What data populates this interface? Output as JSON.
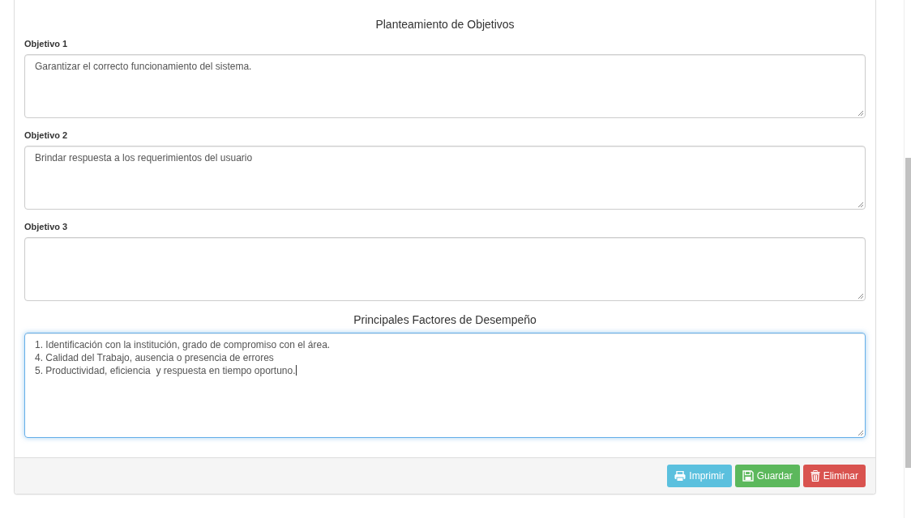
{
  "section_1": {
    "heading": "Planteamiento de Objetivos"
  },
  "objectives": [
    {
      "label": "Objetivo 1",
      "value": "Garantizar el correcto funcionamiento del sistema.",
      "focused": false
    },
    {
      "label": "Objetivo 2",
      "value": "Brindar respuesta a los requerimientos del usuario",
      "focused": false
    },
    {
      "label": "Objetivo 3",
      "focused": false
    }
  ],
  "section_2": {
    "heading": "Principales Factores de Desempeño"
  },
  "factors": {
    "lines": [
      "1. Identificación con la institución, grado de compromiso con el área.",
      "4. Calidad del Trabajo, ausencia o presencia de errores",
      "5. Productividad, eficiencia  y respuesta en tiempo oportuno."
    ],
    "focused": true
  },
  "buttons": [
    {
      "label": "Imprimir",
      "kind": "print"
    },
    {
      "label": "Guardar",
      "kind": "save"
    },
    {
      "label": "Eliminar",
      "kind": "delete"
    }
  ]
}
